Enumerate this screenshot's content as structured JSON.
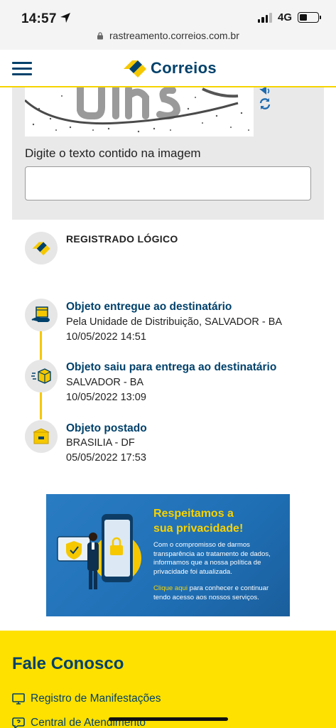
{
  "status_bar": {
    "time": "14:57",
    "network": "4G",
    "battery_level": 0.4,
    "url": "rastreamento.correios.com.br"
  },
  "header": {
    "brand": "Correios",
    "menu_icon": "hamburger-icon",
    "colors": {
      "blue": "#00416b",
      "yellow": "#f5d400"
    }
  },
  "captcha": {
    "label": "Digite o texto contido na imagem",
    "input_value": "",
    "audio_icon": "speaker-icon",
    "refresh_icon": "refresh-icon"
  },
  "tracking": {
    "registered_label": "REGISTRADO LÓGICO",
    "events": [
      {
        "title": "Objeto entregue ao destinatário",
        "detail": "Pela Unidade de Distribuição, SALVADOR - BA",
        "datetime": "10/05/2022 14:51",
        "icon": "delivered-package-icon"
      },
      {
        "title": "Objeto saiu para entrega ao destinatário",
        "detail": "SALVADOR - BA",
        "datetime": "10/05/2022 13:09",
        "icon": "package-in-transit-icon"
      },
      {
        "title": "Objeto postado",
        "detail": "BRASILIA - DF",
        "datetime": "05/05/2022 17:53",
        "icon": "package-posted-icon"
      }
    ]
  },
  "banner": {
    "heading_line1": "Respeitamos a",
    "heading_line2": "sua privacidade!",
    "body": "Com o compromisso de darmos transparência ao tratamento de dados, informamos que a nossa política de privacidade foi atualizada.",
    "link": "Clique aqui",
    "link_rest": " para conhecer e continuar tendo acesso aos nossos serviços."
  },
  "footer": {
    "title": "Fale Conosco",
    "items": [
      {
        "label": "Registro de Manifestações",
        "icon": "monitor-icon"
      },
      {
        "label": "Central de Atendimento",
        "icon": "chat-question-icon"
      }
    ]
  }
}
